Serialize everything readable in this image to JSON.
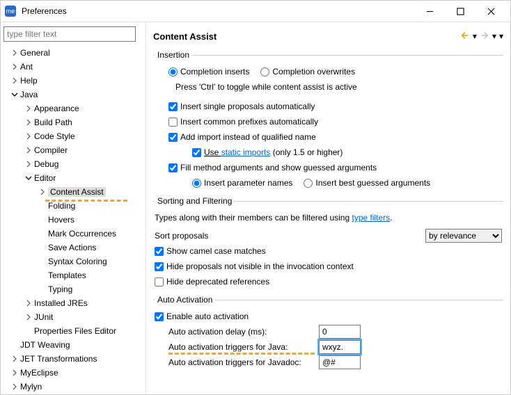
{
  "window": {
    "title": "Preferences",
    "app_icon": "me"
  },
  "sidebar": {
    "filter_placeholder": "type filter text",
    "items": [
      {
        "label": "General",
        "level": 0,
        "chev": "right"
      },
      {
        "label": "Ant",
        "level": 0,
        "chev": "right"
      },
      {
        "label": "Help",
        "level": 0,
        "chev": "right"
      },
      {
        "label": "Java",
        "level": 0,
        "chev": "down"
      },
      {
        "label": "Appearance",
        "level": 1,
        "chev": "right"
      },
      {
        "label": "Build Path",
        "level": 1,
        "chev": "right"
      },
      {
        "label": "Code Style",
        "level": 1,
        "chev": "right"
      },
      {
        "label": "Compiler",
        "level": 1,
        "chev": "right"
      },
      {
        "label": "Debug",
        "level": 1,
        "chev": "right"
      },
      {
        "label": "Editor",
        "level": 1,
        "chev": "down"
      },
      {
        "label": "Content Assist",
        "level": 2,
        "chev": "right",
        "selected": true
      },
      {
        "label": "Folding",
        "level": 2,
        "chev": ""
      },
      {
        "label": "Hovers",
        "level": 2,
        "chev": ""
      },
      {
        "label": "Mark Occurrences",
        "level": 2,
        "chev": ""
      },
      {
        "label": "Save Actions",
        "level": 2,
        "chev": ""
      },
      {
        "label": "Syntax Coloring",
        "level": 2,
        "chev": ""
      },
      {
        "label": "Templates",
        "level": 2,
        "chev": ""
      },
      {
        "label": "Typing",
        "level": 2,
        "chev": ""
      },
      {
        "label": "Installed JREs",
        "level": 1,
        "chev": "right"
      },
      {
        "label": "JUnit",
        "level": 1,
        "chev": "right"
      },
      {
        "label": "Properties Files Editor",
        "level": 1,
        "chev": ""
      },
      {
        "label": "JDT Weaving",
        "level": 0,
        "chev": ""
      },
      {
        "label": "JET Transformations",
        "level": 0,
        "chev": "right"
      },
      {
        "label": "MyEclipse",
        "level": 0,
        "chev": "right"
      },
      {
        "label": "Mylyn",
        "level": 0,
        "chev": "right"
      }
    ]
  },
  "content": {
    "title": "Content Assist",
    "insertion": {
      "legend": "Insertion",
      "completion_inserts": "Completion inserts",
      "completion_overwrites": "Completion overwrites",
      "toggle_hint": "Press 'Ctrl' to toggle while content assist is active",
      "insert_single": "Insert single proposals automatically",
      "insert_common": "Insert common prefixes automatically",
      "add_import": "Add import instead of qualified name",
      "use_static": "Use ",
      "static_link": "static imports",
      "static_tail": " (only 1.5 or higher)",
      "fill_method": "Fill method arguments and show guessed arguments",
      "insert_param": "Insert parameter names",
      "insert_best": "Insert best guessed arguments"
    },
    "sorting": {
      "legend": "Sorting and Filtering",
      "hint_pre": "Types along with their members can be filtered using ",
      "hint_link": "type filters",
      "hint_post": ".",
      "sort_label": "Sort proposals",
      "sort_value": "by relevance",
      "camel": "Show camel case matches",
      "hide_nv": "Hide proposals not visible in the invocation context",
      "hide_dep": "Hide deprecated references"
    },
    "auto": {
      "legend": "Auto Activation",
      "enable": "Enable auto activation",
      "delay_label": "Auto activation delay (ms):",
      "delay_val": "0",
      "java_label": "Auto activation triggers for Java:",
      "java_val": "wxyz.",
      "jdoc_label": "Auto activation triggers for Javadoc:",
      "jdoc_val": "@#"
    }
  }
}
